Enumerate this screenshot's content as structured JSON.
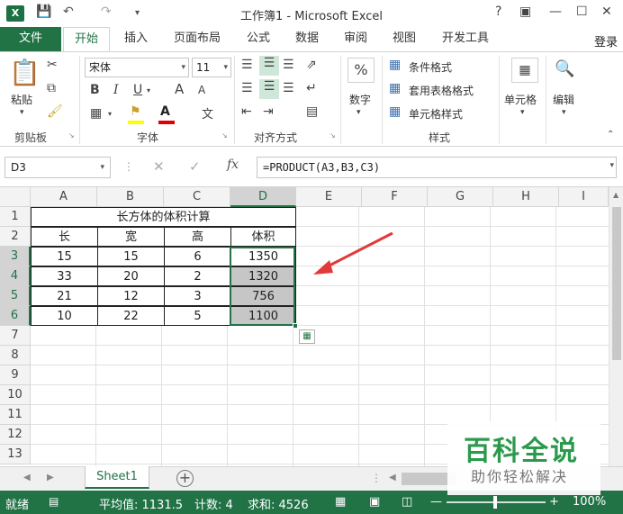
{
  "window": {
    "app_icon": "X",
    "title": "工作簿1 - Microsoft Excel",
    "help": "?",
    "controls": [
      "restore-ribbon",
      "minimize",
      "maximize",
      "close"
    ]
  },
  "tabs": [
    {
      "label": "文件"
    },
    {
      "label": "开始"
    },
    {
      "label": "插入"
    },
    {
      "label": "页面布局"
    },
    {
      "label": "公式"
    },
    {
      "label": "数据"
    },
    {
      "label": "审阅"
    },
    {
      "label": "视图"
    },
    {
      "label": "开发工具"
    }
  ],
  "active_tab": "开始",
  "login_label": "登录",
  "ribbon": {
    "clipboard": {
      "paste_label": "粘贴",
      "group_label": "剪贴板"
    },
    "font": {
      "font_name": "宋体",
      "font_size": "11",
      "bold": "B",
      "italic": "I",
      "underline": "U",
      "grow": "A",
      "shrink": "A",
      "phonetic": "文",
      "group_label": "字体"
    },
    "alignment": {
      "group_label": "对齐方式"
    },
    "number": {
      "percent": "%",
      "label": "数字"
    },
    "styles": {
      "conditional": "条件格式",
      "table": "套用表格格式",
      "cell_styles": "单元格样式",
      "group_label": "样式"
    },
    "cells": {
      "label": "单元格"
    },
    "editing": {
      "label": "编辑"
    }
  },
  "formula_bar": {
    "name_box": "D3",
    "fx": "fx",
    "formula": "=PRODUCT(A3,B3,C3)"
  },
  "columns": [
    "A",
    "B",
    "C",
    "D",
    "E",
    "F",
    "G",
    "H",
    "I"
  ],
  "rows": [
    "1",
    "2",
    "3",
    "4",
    "5",
    "6",
    "7",
    "8",
    "9",
    "10",
    "11",
    "12",
    "13"
  ],
  "sheet": {
    "title_cell": "长方体的体积计算",
    "headers": [
      "长",
      "宽",
      "高",
      "体积"
    ],
    "data": [
      [
        "15",
        "15",
        "6",
        "1350"
      ],
      [
        "33",
        "20",
        "2",
        "1320"
      ],
      [
        "21",
        "12",
        "3",
        "756"
      ],
      [
        "10",
        "22",
        "5",
        "1100"
      ]
    ]
  },
  "sheet_tabs": [
    "Sheet1"
  ],
  "status": {
    "ready": "就绪",
    "average": "平均值: 1131.5",
    "count": "计数: 4",
    "sum": "求和: 4526",
    "zoom": "100%"
  },
  "watermark": {
    "title": "百科全说",
    "subtitle": "助你轻松解决"
  },
  "colors": {
    "excel_green": "#217346",
    "arrow_red": "#e23a3a",
    "watermark_green": "#2b9a4d"
  }
}
